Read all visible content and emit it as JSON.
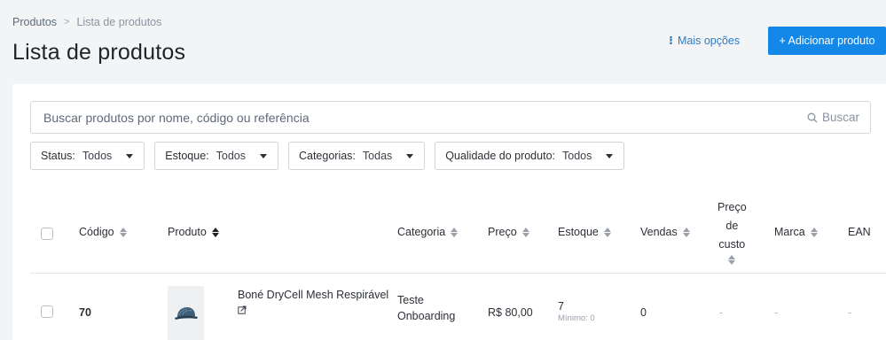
{
  "breadcrumb": {
    "items": [
      "Produtos",
      "Lista de produtos"
    ],
    "separator": ">"
  },
  "page": {
    "title": "Lista de produtos",
    "more_options": "Mais opções",
    "add_button": "+ Adicionar produto"
  },
  "search": {
    "placeholder": "Buscar produtos por nome, código ou referência",
    "button": "Buscar"
  },
  "filters": [
    {
      "label": "Status:",
      "value": "Todos"
    },
    {
      "label": "Estoque:",
      "value": "Todos"
    },
    {
      "label": "Categorias:",
      "value": "Todas"
    },
    {
      "label": "Qualidade do produto:",
      "value": "Todos"
    }
  ],
  "table": {
    "columns": {
      "codigo": "Código",
      "produto": "Produto",
      "categoria": "Categoria",
      "preco": "Preço",
      "estoque": "Estoque",
      "vendas": "Vendas",
      "preco_custo": [
        "Preço",
        "de",
        "custo"
      ],
      "marca": "Marca",
      "ean": "EAN"
    },
    "rows": [
      {
        "codigo": "70",
        "produto": "Boné DryCell Mesh Respirável",
        "categoria": [
          "Teste",
          "Onboarding"
        ],
        "preco": "R$ 80,00",
        "estoque": "7",
        "estoque_min": "Mínimo: 0",
        "vendas": "0",
        "preco_custo": "-",
        "marca": "-",
        "ean": "-"
      }
    ]
  },
  "colors": {
    "primary": "#1388e8",
    "link": "#2d7bc4",
    "background": "#f3f4f6"
  }
}
